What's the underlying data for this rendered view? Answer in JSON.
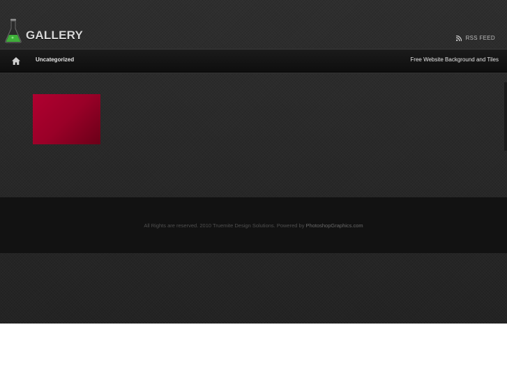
{
  "header": {
    "logo_text": "GALLERY",
    "rss_label": "RSS FEED"
  },
  "nav": {
    "left_item": "Uncategorized",
    "right_item": "Free Website Background and Tiles"
  },
  "footer": {
    "text": "All Rights are reserved. 2010 Truemite Design Solutions. Powered by ",
    "link": "PhotoshopGraphics.com"
  },
  "colors": {
    "background": "#262626",
    "nav": "#141414",
    "footer": "#121212",
    "thumbnail": "#a3002b",
    "logo_flask": "#3fae3a"
  },
  "icons": [
    "flask-icon",
    "rss-icon",
    "home-icon"
  ]
}
